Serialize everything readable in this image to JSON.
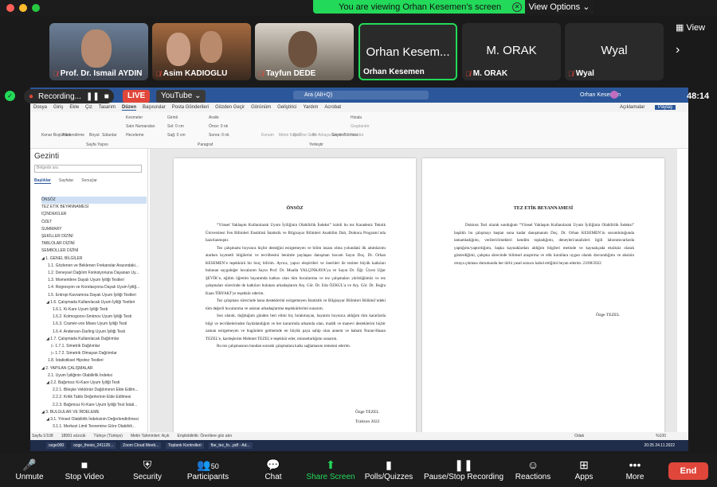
{
  "banner": {
    "text": "You are viewing Orhan Kesemen's screen",
    "view_options": "View Options ⌄"
  },
  "top_right": {
    "view_label": "View",
    "next_arrow": "›"
  },
  "participants": [
    {
      "name": "Prof. Dr. Ismail AYDIN",
      "muted": true
    },
    {
      "name": "Asim KADIOGLU",
      "muted": true
    },
    {
      "name": "Tayfun DEDE",
      "muted": true
    },
    {
      "big_name": "Orhan Kesem...",
      "name": "Orhan Kesemen",
      "muted": false,
      "active": true
    },
    {
      "big_name": "M. ORAK",
      "name": "M. ORAK",
      "muted": true
    },
    {
      "big_name": "Wyal",
      "name": "Wyal",
      "muted": true
    }
  ],
  "recording": {
    "label": "Recording...",
    "live": "LIVE",
    "youtube": "YouTube ⌄",
    "timer": "48:14"
  },
  "word": {
    "search": "Ara (Alt+Q)",
    "user": "Orhan Kesemen",
    "comments": "Açıklamalar",
    "share": "Paylaş",
    "menu": [
      "Dosya",
      "Giriş",
      "Ekle",
      "Çiz",
      "Tasarım",
      "Düzen",
      "Başvurular",
      "Posta Gönderileri",
      "Gözden Geçir",
      "Görünüm",
      "Geliştirici",
      "Yardım",
      "Acrobat"
    ],
    "ribbon_groups": [
      "Kenar Boşlukları",
      "Yönlendirme",
      "Boyut",
      "Sütunlar",
      "Kesmeler",
      "Satır Numaraları",
      "Heceleme",
      "Girinti",
      "Sol: 0 cm",
      "Sağ: 0 cm",
      "Aralık",
      "Önce: 0 nk",
      "Sonra: 0 nk",
      "Konum",
      "Metni Kaydır",
      "Bir Öne Getir",
      "Bir Arkaya Gönder",
      "Seçim Bölmesi",
      "Hizala",
      "Gruplandır",
      "Döndür"
    ],
    "ribbon_sections": [
      "Sayfa Yapısı",
      "Paragraf",
      "Yerleştir"
    ]
  },
  "nav": {
    "title": "Gezinti",
    "search_placeholder": "Belgede ara",
    "tabs": [
      "Başlıklar",
      "Sayfalar",
      "Sonuçlar"
    ],
    "items": [
      "ÖNSÖZ",
      "TEZ ETİK BEYANNAMESİ",
      "İÇİNDEKİLER",
      "ÖZET",
      "SUMMARY",
      "ŞEKİLLER DİZİNİ",
      "TABLOLAR DİZİNİ",
      "SEMBOLLER DİZİNİ",
      "◢ 1. GENEL BİLGİLER",
      "1.1. Gözlenen ve Beklenen Frekanslar Arasındaki...",
      "1.2. Deneysel Dağılım Fonksiyonuna Dayanan Uy...",
      "1.3. Momentlere Dayalı Uyum İyiliği Testleri",
      "1.4. Regresyon ve Korelasyona Dayalı Uyum İyiliğ...",
      "1.5. Entropi Kavramına Dayalı Uyum İyiliği Testleri",
      "◢ 1.6. Çalışmada Kullanılacak Uyum İyiliği Testleri",
      "1.6.1. Ki-Kare Uyum İyiliği Testi",
      "1.6.2. Kolmogorov-Smirnov Uyum İyiliği Testi",
      "1.6.3. Cramér-von Mises Uyum İyiliği Testi",
      "1.6.4. Anderson-Darling Uyum İyiliği Testi",
      "◢ 1.7. Çalışmada Kullanılacak Dağılımlar",
      "▷ 1.7.1. Simetrik Dağılımlar",
      "▷ 1.7.2. Simetrik Olmayan Dağılımlar",
      "1.8. İstatistiksel Hipotez Testleri",
      "◢ 2. YAPILAN ÇALIŞMALAR",
      "2.1. Uyum İyiliğinin Olabilirlik İndeksi",
      "◢ 2.2. Bağımsız Ki-Kare Uyum İyiliği Testi",
      "2.2.1. Bileşke Vektörün Dağılımının Elde Edilm...",
      "2.2.2. Kritik Tablo Değerlerinin Elde Edilmesi",
      "2.2.3. Bağımsız Ki-Kare Uyum İyiliği Test İstati...",
      "◢ 3. BULGULAR VE İRDELEME",
      "◢ 3.1. Yönsel Olabilirlik İndeksinin Değerlendirilmesi",
      "3.1.1. Merkezi Limit Teoremine Göre Olabilirli..."
    ]
  },
  "page1": {
    "title": "ÖNSÖZ",
    "p1": "“Yönsel Yaklaşım Kullanılarak Uyum İyiliğinin Olabilirlik İndeksi” isimli bu tez Karadeniz Teknik Üniversitesi Fen Bilimleri Enstitüsü İstatistik ve Bilgisayar Bilimleri Anabilim Dalı, Doktora Programı’nda hazırlanmıştır.",
    "p2": "Tez çalışmamı boyunca hiçbir desteğini esirgemeyen ve bilim insanı olma yolundaki ilk adımlarımı atarken kıymetli bilgilerini ve tecrübesini benimle paylaşan danışman hocam Sayın Doç. Dr. Orhan KESEMEN’e teşekkürü bir borç bilirim. Ayrıca, yapıcı eleştirileri ve önerileri ile tezime büyük katkıları bulunan saygıdeğer hocalarım Sayın Prof. Dr. Mualla YALÇINKAYA’ya ve Sayın Dr. Öğr. Üyesi Uğur ŞEVİK’e, eğitim öğretim hayatımda katkısı olan tüm hocalarıma ve tez çalışmaları yürütüğümüz ve tez çalışmaları sürecinde de katkıları bulunan arkadaşlarım Arş. Gör. Dr. Eda ÖZKUL’a ve Arş. Gör. Dr. Buğra Kaan TİRYAKİ’ye teşekkür ederim.",
    "p3": "Tez çalışması sürecinde bana desteklerini esirgemeyen İstatistik ve Bilgisayar Bilimleri Bölümü’ndeki tüm değerli hocalarıma ve asistan arkadaşlarıma teşekkürlerimi sunarım.",
    "p4": "Son olarak, doğduğum günden beri elimi hiç bırakmayan, hayatım boyunca aldığım tüm kararlarda bilgi ve tecrübelerinden faydalandığım ve her kararımda arkamda olan, maddi ve manevi desteklerini hiçbir zaman esirgemeyen ve bugünlere gelmemde en büyük paya sahip olan annem ve babam Nuran-Hasan TEZEL’e, kardeşlerim Mehmet TEZEL’e teşekkür eder, minnettarlığımı sunarım.",
    "p5": "Bu tez çalışmasının bundan sonraki çalışmalara katkı sağlamasını temenni ederim.",
    "sig_name": "Özge TEZEL",
    "sig_place": "Trabzon 2022"
  },
  "page2": {
    "title": "TEZ ETİK BEYANNAMESİ",
    "p1": "Doktora Tezi olarak sunduğum “Yönsel Yaklaşım Kullanılarak Uyum İyiliğinin Olabilirlik İndeksi” başlıklı bu çalışmayı baştan sona kadar danışmanım Doç. Dr. Orhan KESEMEN’in sorumluluğunda tamamladığımı, verileri/örnekleri kendim topladığımı, deneyleri/analizleri ilgili laboratuvarlarda yaptığımı/yaptırdığımı, başka kaynaklardan aldığım bilgileri metinde ve kaynakçada eksiksiz olarak gösterdiğimi, çalışma sürecinde bilimsel araştırma ve etik kurallara uygun olarak davrandığımı ve aksinin ortaya çıkması durumunda her türlü yasal sonucu kabul ettiğimi beyan ederim. 23/08/2022",
    "sig_name": "Özge TEZEL"
  },
  "status": [
    "Sayfa 1/108",
    "18991 sözcük",
    "Türkçe (Türkiye)",
    "Metin Tahminleri: Açık",
    "Erişilebilirlik: Önerilere göz atın",
    "Odak",
    "%100"
  ],
  "taskbar": [
    "ozge000",
    "ozge_thesis_241128...",
    "Zoom Cloud Meeti...",
    "Toplantı Kontrolleri",
    "fbe_tez_fo...pdf - Ad..."
  ],
  "taskbar_clock": "20:25 24.11.2022",
  "toolbar": [
    {
      "label": "Unmute",
      "icon": "🎤"
    },
    {
      "label": "Stop Video",
      "icon": "■"
    },
    {
      "label": "Security",
      "icon": "⛨"
    },
    {
      "label": "Participants",
      "icon": "👥",
      "count": "50"
    },
    {
      "label": "Chat",
      "icon": "💬"
    },
    {
      "label": "Share Screen",
      "icon": "⬆"
    },
    {
      "label": "Polls/Quizzes",
      "icon": "▮"
    },
    {
      "label": "Pause/Stop Recording",
      "icon": "❚❚"
    },
    {
      "label": "Reactions",
      "icon": "☺"
    },
    {
      "label": "Apps",
      "icon": "⊞"
    },
    {
      "label": "More",
      "icon": "•••"
    }
  ],
  "end_label": "End"
}
